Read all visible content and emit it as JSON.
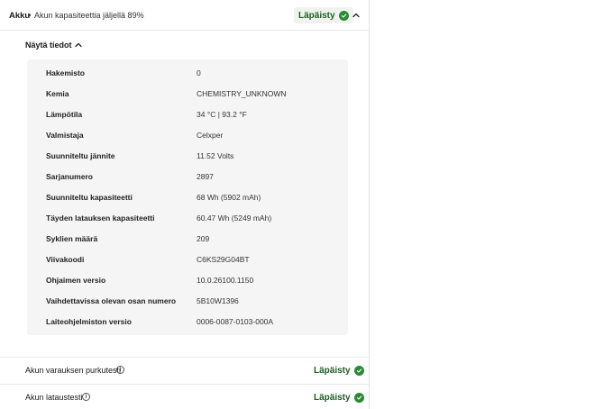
{
  "header": {
    "title": "Akku",
    "separator": "•",
    "subtitle": "Akun kapasiteettia jäljellä 89%",
    "status": "Läpäisty"
  },
  "details_toggle": "Näytä tiedot",
  "details": [
    {
      "label": "Hakemisto",
      "value": "0"
    },
    {
      "label": "Kemia",
      "value": "CHEMISTRY_UNKNOWN"
    },
    {
      "label": "Lämpötila",
      "value": "34 °C | 93.2 °F"
    },
    {
      "label": "Valmistaja",
      "value": "Celxper"
    },
    {
      "label": "Suunniteltu jännite",
      "value": "11.52 Volts"
    },
    {
      "label": "Sarjanumero",
      "value": "2897"
    },
    {
      "label": "Suunniteltu kapasiteetti",
      "value": "68 Wh (5902 mAh)"
    },
    {
      "label": "Täyden latauksen kapasiteetti",
      "value": "60.47 Wh (5249 mAh)"
    },
    {
      "label": "Syklien määrä",
      "value": "209"
    },
    {
      "label": "Viivakoodi",
      "value": "C6KS29G04BT"
    },
    {
      "label": "Ohjaimen versio",
      "value": "10.0.26100.1150"
    },
    {
      "label": "Vaihdettavissa olevan osan numero",
      "value": "5B10W1396"
    },
    {
      "label": "Laiteohjelmiston versio",
      "value": "0006-0087-0103-000A"
    }
  ],
  "tests": [
    {
      "label": "Akun varauksen purkutesti",
      "status": "Läpäisty",
      "info": "i"
    },
    {
      "label": "Akun lataustesti",
      "status": "Läpäisty",
      "info": "i"
    }
  ],
  "colors": {
    "pass": "#2a8a38",
    "pass_text": "#1e5e22",
    "details_bg": "#f5f5f5"
  }
}
